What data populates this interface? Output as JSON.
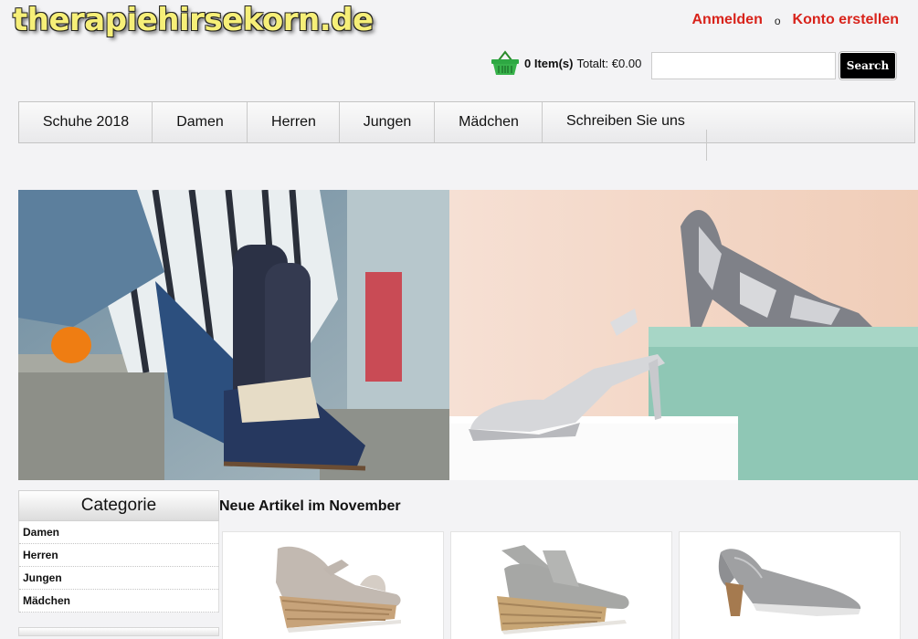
{
  "header": {
    "logo_text": "therapiehirsekorn.de",
    "login_label": "Anmelden",
    "separator": "o",
    "register_label": "Konto erstellen",
    "cart_icon": "shopping-basket-icon",
    "cart_count": "0 Item(s)",
    "cart_total": "Totalt: €0.00",
    "search_placeholder": "",
    "search_label": "Search"
  },
  "nav": {
    "items": [
      "Schuhe 2018",
      "Damen",
      "Herren",
      "Jungen",
      "Mädchen"
    ],
    "contact_label": "Schreiben Sie uns"
  },
  "sidebar": {
    "title": "Categorie",
    "items": [
      "Damen",
      "Herren",
      "Jungen",
      "Mädchen"
    ]
  },
  "main": {
    "section_title": "Neue Artikel im November"
  },
  "colors": {
    "link_red": "#d8231b",
    "logo_yellow": "#f6ef78",
    "banner_mint": "#8fc7b5",
    "banner_peach": "#f1d2c0"
  }
}
